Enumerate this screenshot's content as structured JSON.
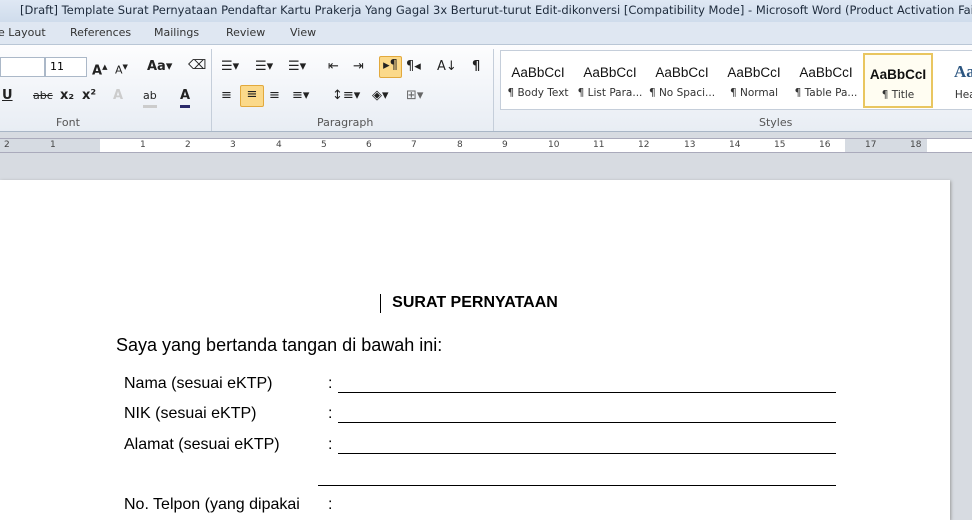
{
  "title": "[Draft] Template Surat Pernyataan Pendaftar Kartu Prakerja Yang Gagal 3x Berturut-turut Edit-dikonversi [Compatibility Mode]  -  Microsoft Word (Product Activation Failed)",
  "tabs": [
    "e Layout",
    "References",
    "Mailings",
    "Review",
    "View"
  ],
  "font": {
    "size": "11",
    "label": "Font"
  },
  "paragraph": {
    "label": "Paragraph"
  },
  "styles": {
    "label": "Styles",
    "items": [
      {
        "sample": "AaBbCcI",
        "name": "¶ Body Text"
      },
      {
        "sample": "AaBbCcI",
        "name": "¶ List Para..."
      },
      {
        "sample": "AaBbCcI",
        "name": "¶ No Spaci..."
      },
      {
        "sample": "AaBbCcI",
        "name": "¶ Normal"
      },
      {
        "sample": "AaBbCcI",
        "name": "¶ Table Pa..."
      },
      {
        "sample": "AaBbCcI",
        "name": "¶ Title",
        "selected": true
      },
      {
        "sample": "AaB",
        "name": "Headi"
      }
    ]
  },
  "ruler": [
    "2",
    "1",
    "1",
    "2",
    "3",
    "4",
    "5",
    "6",
    "7",
    "8",
    "9",
    "10",
    "11",
    "12",
    "13",
    "14",
    "15",
    "16",
    "17",
    "18"
  ],
  "doc": {
    "heading": "SURAT PERNYATAAN",
    "intro": "Saya yang bertanda tangan di bawah ini:",
    "fields": [
      {
        "label": "Nama (sesuai eKTP)",
        "colon": ":"
      },
      {
        "label": "NIK (sesuai eKTP)",
        "colon": ":"
      },
      {
        "label": "Alamat (sesuai eKTP)",
        "colon": ":"
      },
      {
        "label": "No. Telpon (yang dipakai",
        "colon": ":"
      }
    ]
  }
}
